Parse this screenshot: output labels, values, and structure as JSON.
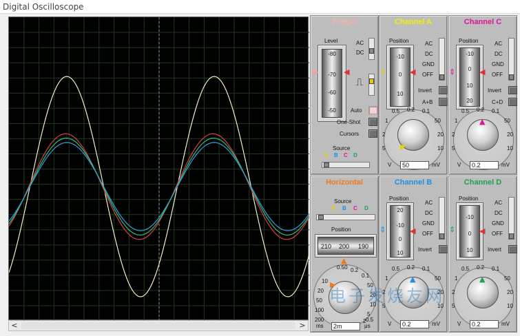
{
  "window": {
    "title": "Digital Oscilloscope"
  },
  "trigger": {
    "title": "Trigger",
    "level_label": "Level",
    "level_ticks": [
      "-80",
      "-70",
      "-60",
      "-50"
    ],
    "coupling": [
      "AC",
      "DC"
    ],
    "auto_label": "Auto",
    "oneshot_label": "One-Shot",
    "cursors_label": "Cursors",
    "source_label": "Source",
    "sources": [
      "A",
      "B",
      "C",
      "D"
    ]
  },
  "channel_a": {
    "title": "Channel A",
    "position_label": "Position",
    "ticks": [
      "-10",
      "0",
      "10"
    ],
    "modes": [
      "AC",
      "DC",
      "GND",
      "OFF"
    ],
    "invert_label": "Invert",
    "sum_label": "A+B",
    "dial_ticks": [
      "0.5",
      "0.2",
      "0.1",
      "50",
      "20",
      "10",
      "5",
      "2",
      "1"
    ],
    "unit_left": "V",
    "value": "50",
    "unit_right": "mV",
    "color": "#f2f200"
  },
  "channel_c": {
    "title": "Channel C",
    "position_label": "Position",
    "ticks": [
      "-10",
      "0",
      "10",
      "20"
    ],
    "modes": [
      "AC",
      "DC",
      "GND",
      "OFF"
    ],
    "invert_label": "Invert",
    "sum_label": "C+D",
    "dial_ticks": [
      "0.5",
      "0.2",
      "0.1",
      "50",
      "20",
      "10",
      "5",
      "2",
      "1"
    ],
    "unit_left": "V",
    "value": "0.2",
    "unit_right": "mV",
    "color": "#e0149a"
  },
  "horizontal": {
    "title": "Horizontal",
    "source_label": "Source",
    "sources": [
      "A",
      "B",
      "C",
      "D"
    ],
    "position_label": "Position",
    "position_ticks": [
      "210",
      "200",
      "190"
    ],
    "dial_ticks": [
      "0.50",
      "0.2",
      "0.1",
      "50",
      "20",
      "10",
      "5",
      "2",
      "1",
      "0.5",
      "200",
      "100",
      "50",
      "20",
      "10"
    ],
    "unit_left": "ms",
    "value": "2m",
    "unit_right": "μs",
    "color": "#f07a1e"
  },
  "channel_b": {
    "title": "Channel B",
    "position_label": "Position",
    "ticks": [
      "20",
      "-10",
      "0",
      "10"
    ],
    "modes": [
      "AC",
      "DC",
      "GND",
      "OFF"
    ],
    "invert_label": "Invert",
    "dial_ticks": [
      "0.5",
      "0.2",
      "0.1",
      "50",
      "20",
      "10",
      "5",
      "2",
      "1"
    ],
    "unit_left": "V",
    "value": "0.2",
    "unit_right": "mV",
    "color": "#1e8fe0"
  },
  "channel_d": {
    "title": "Channel D",
    "position_label": "Position",
    "ticks": [
      "-10",
      "0",
      "10"
    ],
    "modes": [
      "AC",
      "DC",
      "GND",
      "OFF"
    ],
    "invert_label": "Invert",
    "dial_ticks": [
      "0.5",
      "0.2",
      "0.1",
      "50",
      "20",
      "10",
      "5",
      "2",
      "1"
    ],
    "unit_left": "V",
    "value": "0.2",
    "unit_right": "mV",
    "color": "#1ea050"
  },
  "scrollbar": {
    "left": "<",
    "right": ">"
  },
  "watermark": "电子发烧友网",
  "traces": [
    {
      "name": "yellow",
      "color": "#f0f0c8",
      "amplitude": 1.0,
      "phase": 0
    },
    {
      "name": "red",
      "color": "#e04040",
      "amplitude": 0.48,
      "phase": 0.05
    },
    {
      "name": "green",
      "color": "#30c080",
      "amplitude": 0.44,
      "phase": 0.02
    },
    {
      "name": "blue",
      "color": "#30a0e0",
      "amplitude": 0.4,
      "phase": 0.0
    }
  ]
}
